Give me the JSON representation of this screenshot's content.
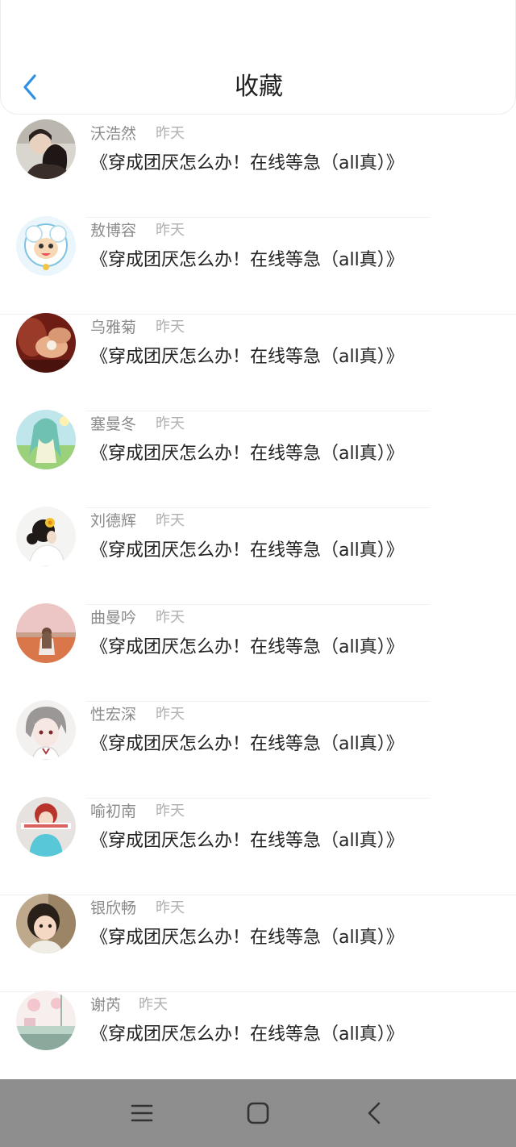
{
  "header": {
    "title": "收藏",
    "back_icon": "chevron-left-icon",
    "accent": "#2f8fe6"
  },
  "favorites": [
    {
      "name": "沃浩然",
      "time": "昨天",
      "text": "《穿成团厌怎么办！在线等急（all真）》",
      "avatar": "avatar-couple"
    },
    {
      "name": "敖博容",
      "time": "昨天",
      "text": "《穿成团厌怎么办！在线等急（all真）》",
      "avatar": "avatar-cartoon-sheep"
    },
    {
      "name": "乌雅菊",
      "time": "昨天",
      "text": "《穿成团厌怎么办！在线等急（all真）》",
      "avatar": "avatar-hands"
    },
    {
      "name": "塞曼冬",
      "time": "昨天",
      "text": "《穿成团厌怎么办！在线等急（all真）》",
      "avatar": "avatar-anime-girl"
    },
    {
      "name": "刘德辉",
      "time": "昨天",
      "text": "《穿成团厌怎么办！在线等急（all真）》",
      "avatar": "avatar-girl-flower"
    },
    {
      "name": "曲曼吟",
      "time": "昨天",
      "text": "《穿成团厌怎么办！在线等急（all真）》",
      "avatar": "avatar-field"
    },
    {
      "name": "性宏深",
      "time": "昨天",
      "text": "《穿成团厌怎么办！在线等急（all真）》",
      "avatar": "avatar-anime-boy"
    },
    {
      "name": "喻初南",
      "time": "昨天",
      "text": "《穿成团厌怎么办！在线等急（all真）》",
      "avatar": "avatar-cartoon-girl"
    },
    {
      "name": "银欣畅",
      "time": "昨天",
      "text": "《穿成团厌怎么办！在线等急（all真）》",
      "avatar": "avatar-child"
    },
    {
      "name": "谢芮",
      "time": "昨天",
      "text": "《穿成团厌怎么办！在线等急（all真）》",
      "avatar": "avatar-illustration"
    }
  ],
  "navbar": {
    "menu_icon": "menu-icon",
    "home_icon": "home-square-icon",
    "back_icon": "back-triangle-icon"
  }
}
